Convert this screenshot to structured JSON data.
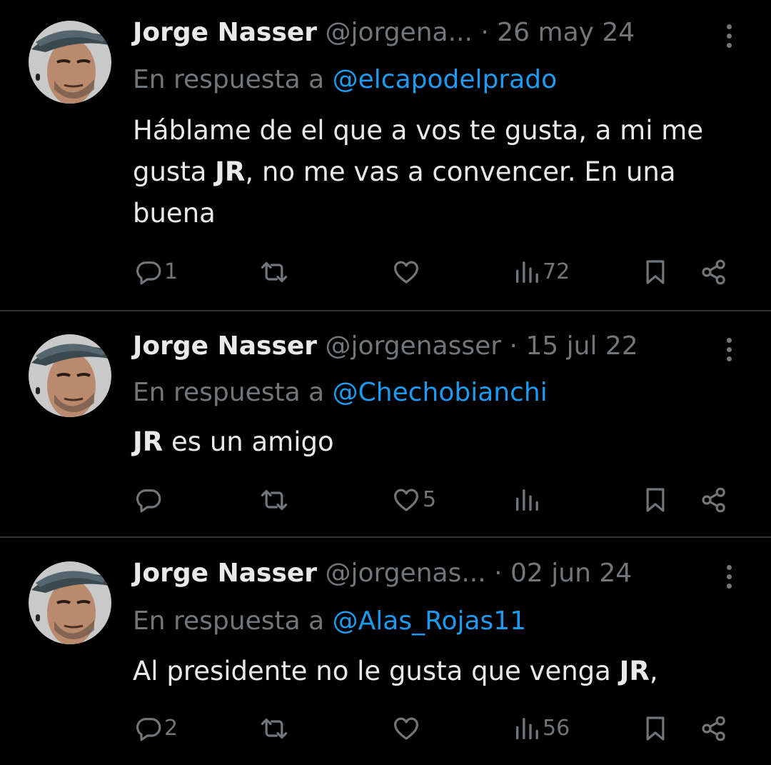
{
  "reply_prefix": "En respuesta a",
  "colors": {
    "background": "#000000",
    "text": "#e7e9ea",
    "muted": "#71767b",
    "mention": "#1d9bf0",
    "divider": "#2f3336"
  },
  "tweets": [
    {
      "author": "Jorge Nasser",
      "handle": "@jorgena...",
      "date": "· 26 may 24",
      "reply_to": "@elcapodelprado",
      "text_parts": [
        "Háblame de el que a vos te gusta, a mi me gusta ",
        "JR",
        ", no me vas a convencer. En una buena"
      ],
      "replies": "1",
      "retweets": "",
      "likes": "",
      "views": "72"
    },
    {
      "author": "Jorge Nasser",
      "handle": "@jorgenasser",
      "date": "· 15 jul 22",
      "reply_to": "@Chechobianchi",
      "text_parts": [
        "",
        "JR",
        " es un amigo"
      ],
      "replies": "",
      "retweets": "",
      "likes": "5",
      "views": ""
    },
    {
      "author": "Jorge Nasser",
      "handle": "@jorgenas...",
      "date": "· 02 jun 24",
      "reply_to": "@Alas_Rojas11",
      "text_parts": [
        "Al presidente no le gusta que venga ",
        "JR",
        ","
      ],
      "replies": "2",
      "retweets": "",
      "likes": "",
      "views": "56"
    }
  ],
  "icons": {
    "reply": "reply-bubble-icon",
    "retweet": "retweet-arrows-icon",
    "like": "heart-icon",
    "views": "bar-chart-icon",
    "bookmark": "bookmark-icon",
    "share": "share-icon",
    "more": "more-vertical-icon"
  }
}
